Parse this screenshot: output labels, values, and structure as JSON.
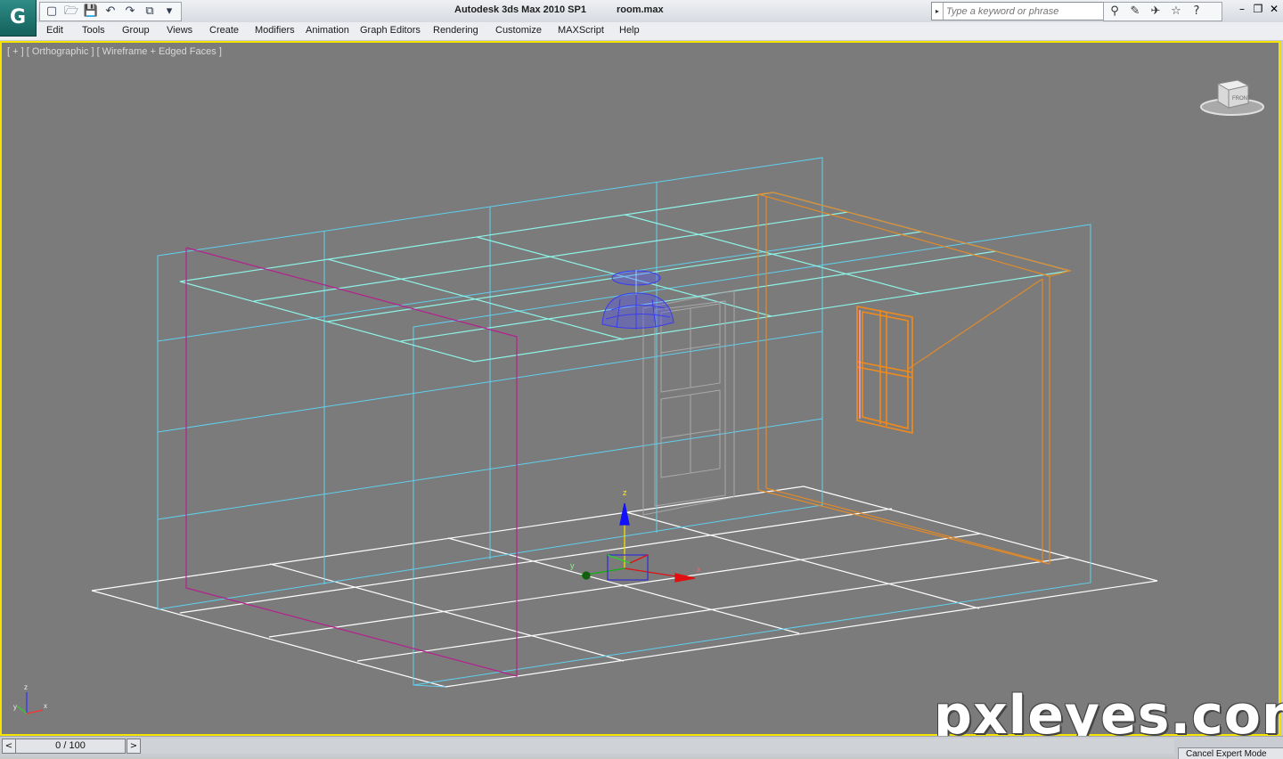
{
  "titlebar": {
    "app_logo": "G",
    "title": "Autodesk 3ds Max  2010 SP1",
    "file": "room.max",
    "qat_icons": [
      "new-file-icon",
      "open-file-icon",
      "save-icon",
      "undo-icon",
      "redo-icon",
      "project-folder-icon",
      "dropdown-icon"
    ],
    "qat_glyphs": [
      "▢",
      "🗁",
      "💾",
      "↶",
      "↷",
      "⧉",
      "▾"
    ],
    "search_placeholder": "Type a keyword or phrase",
    "info_icons": [
      "binoculars-icon",
      "communication-center-icon",
      "favorites-icon",
      "star-icon",
      "help-icon"
    ],
    "info_glyphs": [
      "⚲",
      "✎",
      "✈",
      "☆",
      "?"
    ],
    "window_controls": [
      "–",
      "❐",
      "✕"
    ]
  },
  "menubar": {
    "items": [
      "Edit",
      "Tools",
      "Group",
      "Views",
      "Create",
      "Modifiers",
      "Animation",
      "Graph Editors",
      "Rendering",
      "Customize",
      "MAXScript",
      "Help"
    ]
  },
  "viewport": {
    "label": "[ + ] [ Orthographic ] [ Wireframe + Edged Faces ]",
    "viewcube_face": "FRONT",
    "axis_labels": {
      "x": "x",
      "y": "y",
      "z": "z"
    },
    "colors": {
      "background": "#7b7b7b",
      "active_border": "#f5e400",
      "ceiling_walls": "#5fd0ee",
      "floor": "#ffffff",
      "left_wall_edge": "#b5208f",
      "window_frame": "#f28a1a",
      "lamp": "#3c3cf0"
    }
  },
  "watermark": "pxleyes.com",
  "timeline": {
    "left_arrow": "<",
    "right_arrow": ">",
    "frame": "0 / 100"
  },
  "statusbar": {
    "expert_mode": "Cancel Expert Mode"
  }
}
